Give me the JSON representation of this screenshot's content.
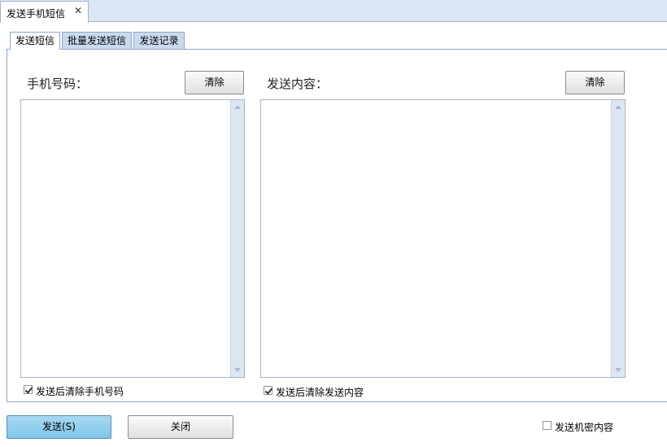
{
  "document_tab": {
    "label": "发送手机短信",
    "close_symbol": "✕"
  },
  "inner_tabs": [
    {
      "label": "发送短信",
      "active": true
    },
    {
      "label": "批量发送短信",
      "active": false
    },
    {
      "label": "发送记录",
      "active": false
    }
  ],
  "phone_section": {
    "label": "手机号码：",
    "clear_label": "清除",
    "value": "",
    "clear_after_send_label": "发送后清除手机号码",
    "clear_after_send_checked": true
  },
  "content_section": {
    "label": "发送内容：",
    "clear_label": "清除",
    "value": "",
    "clear_after_send_label": "发送后清除发送内容",
    "clear_after_send_checked": true
  },
  "footer": {
    "send_label": "发送(S)",
    "close_label": "关闭",
    "confidential_label": "发送机密内容",
    "confidential_checked": false
  },
  "colors": {
    "accent": "#87ceeb",
    "tab_inactive": "#c9daf0",
    "border": "#8ea8c8"
  }
}
